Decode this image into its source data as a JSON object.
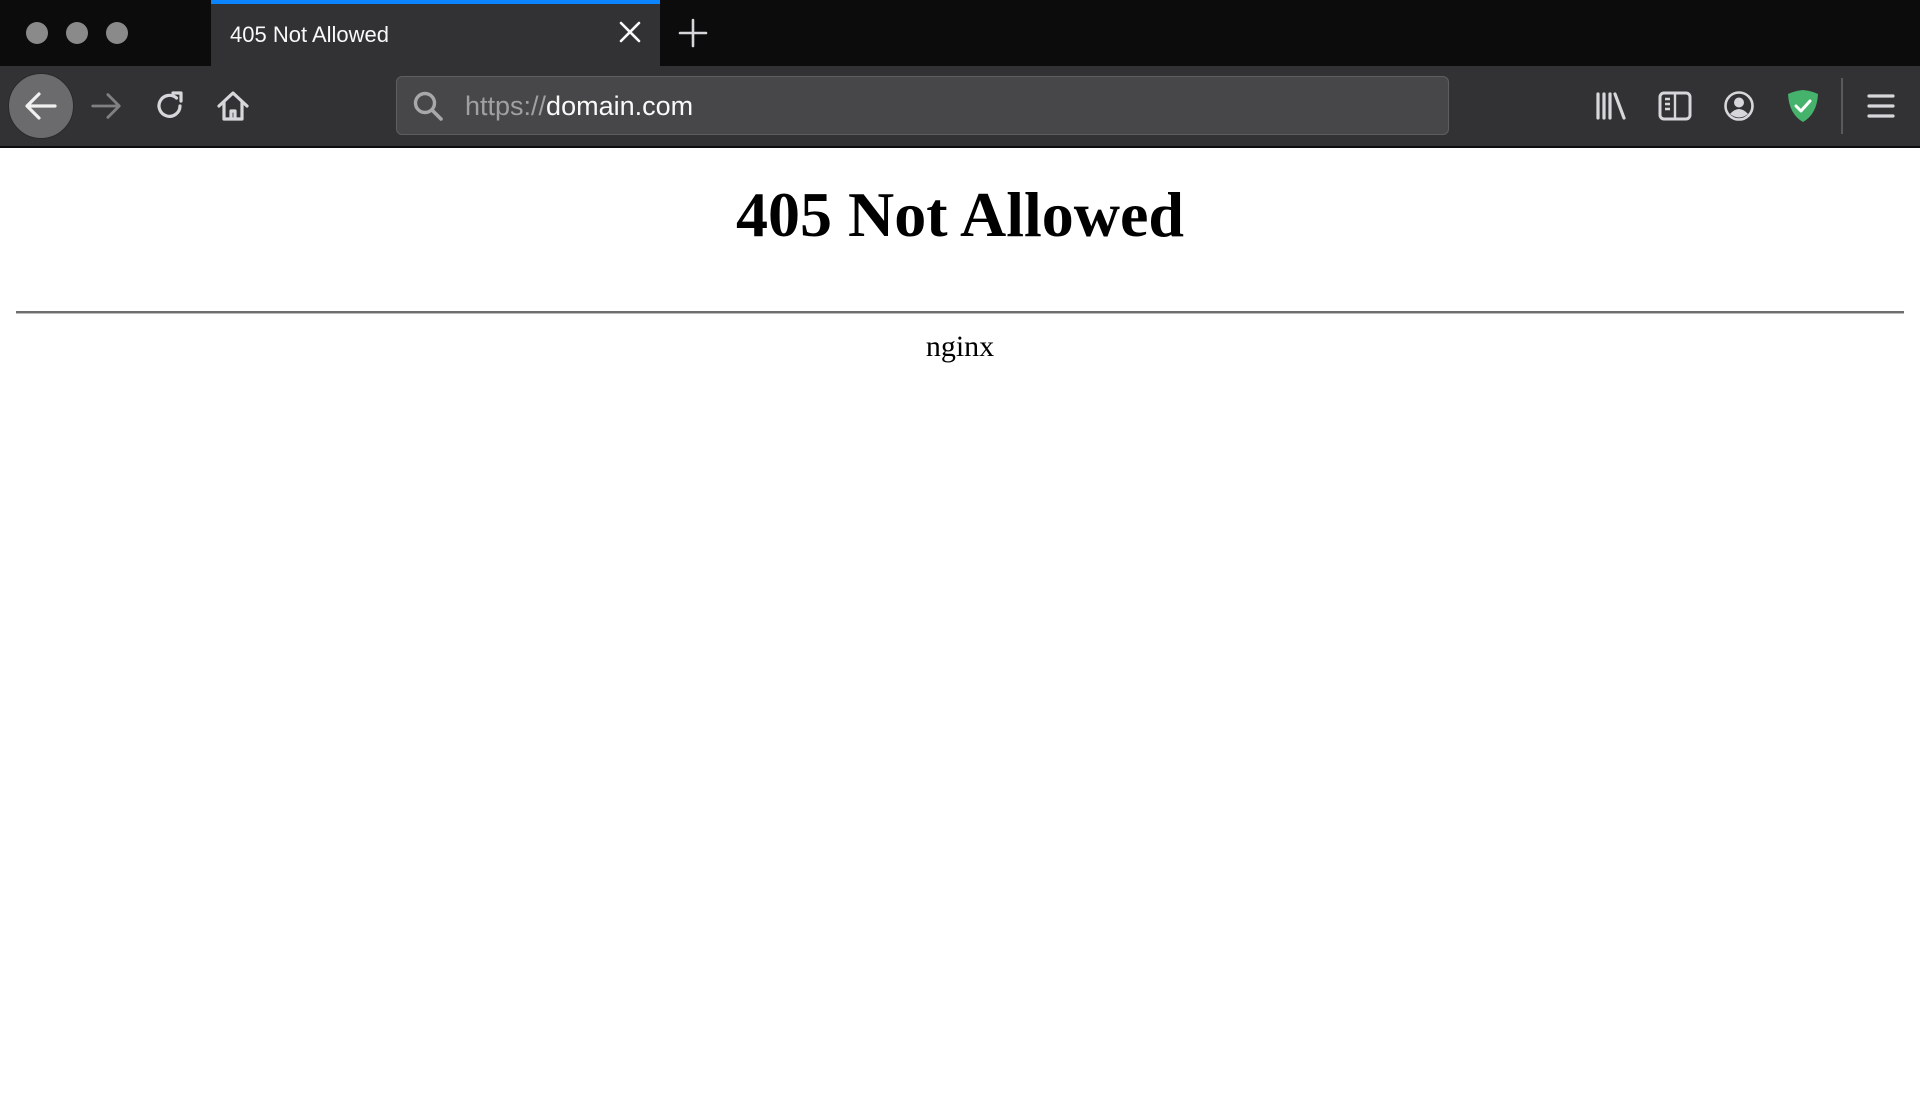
{
  "window": {
    "traffic_lights": [
      "close",
      "minimize",
      "zoom"
    ]
  },
  "tabs": [
    {
      "title": "405 Not Allowed",
      "active": true
    }
  ],
  "toolbar": {
    "url_scheme": "https://",
    "url_host": "domain.com",
    "accent_color": "#0a84ff",
    "shield_color": "#45b36b"
  },
  "page": {
    "heading": "405 Not Allowed",
    "footer": "nginx"
  }
}
